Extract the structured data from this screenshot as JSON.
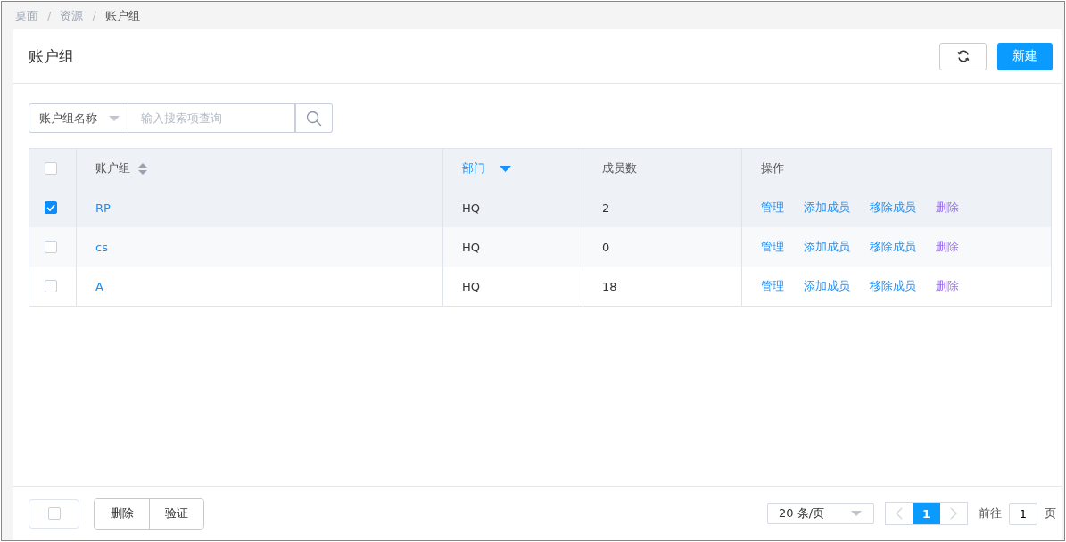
{
  "breadcrumb_separator": "/",
  "breadcrumb": [
    {
      "label": "桌面",
      "current": false
    },
    {
      "label": "资源",
      "current": false
    },
    {
      "label": "账户组",
      "current": true
    }
  ],
  "page_title": "账户组",
  "new_button": "新建",
  "search": {
    "field": "账户组名称",
    "placeholder": "输入搜索项查询"
  },
  "table": {
    "all_checked": false,
    "columns": [
      {
        "label": "账户组",
        "sortable": true,
        "sorted_descending": false
      },
      {
        "label": "部门",
        "sortable": true,
        "sorted_descending": true
      },
      {
        "label": "成员数",
        "sortable": false,
        "sorted_descending": false
      },
      {
        "label": "操作",
        "sortable": false,
        "sorted_descending": false
      }
    ],
    "rows": [
      {
        "selected": true,
        "name": "RP",
        "department": "HQ",
        "members": "2",
        "actions": [
          {
            "label": "管理",
            "visited": false
          },
          {
            "label": "添加成员",
            "visited": false
          },
          {
            "label": "移除成员",
            "visited": false
          },
          {
            "label": "删除",
            "visited": true
          }
        ]
      },
      {
        "selected": false,
        "name": "cs",
        "department": "HQ",
        "members": "0",
        "actions": [
          {
            "label": "管理",
            "visited": false
          },
          {
            "label": "添加成员",
            "visited": false
          },
          {
            "label": "移除成员",
            "visited": false
          },
          {
            "label": "删除",
            "visited": true
          }
        ]
      },
      {
        "selected": false,
        "name": "A",
        "department": "HQ",
        "members": "18",
        "actions": [
          {
            "label": "管理",
            "visited": false
          },
          {
            "label": "添加成员",
            "visited": false
          },
          {
            "label": "移除成员",
            "visited": false
          },
          {
            "label": "删除",
            "visited": true
          }
        ]
      }
    ]
  },
  "footer": {
    "select_all_checked": false,
    "buttons": [
      "删除",
      "验证"
    ]
  },
  "pagination": {
    "page_size": "20 条/页",
    "pages": [
      {
        "label": "1",
        "selected": true
      }
    ],
    "goto_label": "前往",
    "goto_value": "1",
    "page_suffix": "页"
  }
}
